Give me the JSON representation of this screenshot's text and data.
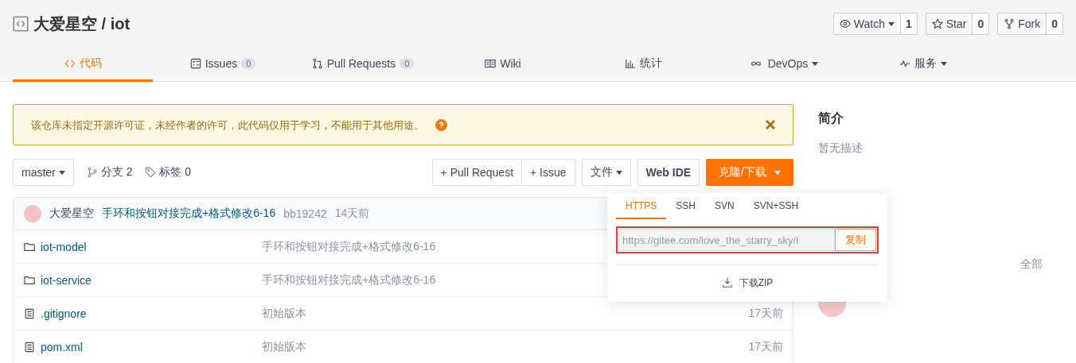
{
  "repo": {
    "owner": "大爱星空",
    "separator": "/",
    "name": "iot"
  },
  "social": [
    {
      "kind": "watch",
      "label": "Watch",
      "count": "1",
      "dropdown": true
    },
    {
      "kind": "star",
      "label": "Star",
      "count": "0",
      "dropdown": false
    },
    {
      "kind": "fork",
      "label": "Fork",
      "count": "0",
      "dropdown": false
    }
  ],
  "tabs": [
    {
      "kind": "code",
      "label": "代码",
      "selected": true
    },
    {
      "kind": "issues",
      "label": "Issues",
      "count": "0",
      "selected": false
    },
    {
      "kind": "pr",
      "label": "Pull Requests",
      "count": "0",
      "selected": false
    },
    {
      "kind": "wiki",
      "label": "Wiki",
      "selected": false
    },
    {
      "kind": "stats",
      "label": "统计",
      "selected": false
    },
    {
      "kind": "devops",
      "label": "DevOps",
      "dropdown": true,
      "selected": false
    },
    {
      "kind": "service",
      "label": "服务",
      "dropdown": true,
      "selected": false
    }
  ],
  "notice": {
    "text": "该仓库未指定开源许可证，未经作者的许可，此代码仅用于学习，不能用于其他用途。"
  },
  "toolbar": {
    "branch": "master",
    "branches": "分支 2",
    "tags": "标签 0",
    "actions": [
      "+ Pull Request",
      "+ Issue"
    ],
    "file_menu": "文件",
    "web_ide": "Web IDE",
    "clone": "克隆/下载"
  },
  "commit": {
    "author": "大爱星空",
    "message": "手环和按钮对接完成+格式修改6-16",
    "sha": "bb19242",
    "time": "14天前"
  },
  "files": [
    {
      "kind": "folder",
      "name": "iot-model",
      "message": "手环和按钮对接完成+格式修改6-16"
    },
    {
      "kind": "folder",
      "name": "iot-service",
      "message": "手环和按钮对接完成+格式修改6-16"
    },
    {
      "kind": "file",
      "name": ".gitignore",
      "message": "初始版本",
      "time": "17天前"
    },
    {
      "kind": "file",
      "name": "pom.xml",
      "message": "初始版本",
      "time": "17天前"
    }
  ],
  "clone_popup": {
    "protocols": [
      {
        "label": "HTTPS",
        "selected": true
      },
      {
        "label": "SSH",
        "selected": false
      },
      {
        "label": "SVN",
        "selected": false
      },
      {
        "label": "SVN+SSH",
        "selected": false
      }
    ],
    "url": "https://gitee.com/love_the_starry_sky/i",
    "copy": "复制",
    "download": "下载ZIP"
  },
  "sidebar": {
    "title": "简介",
    "description": "暂无描述",
    "all_link": "全部"
  }
}
